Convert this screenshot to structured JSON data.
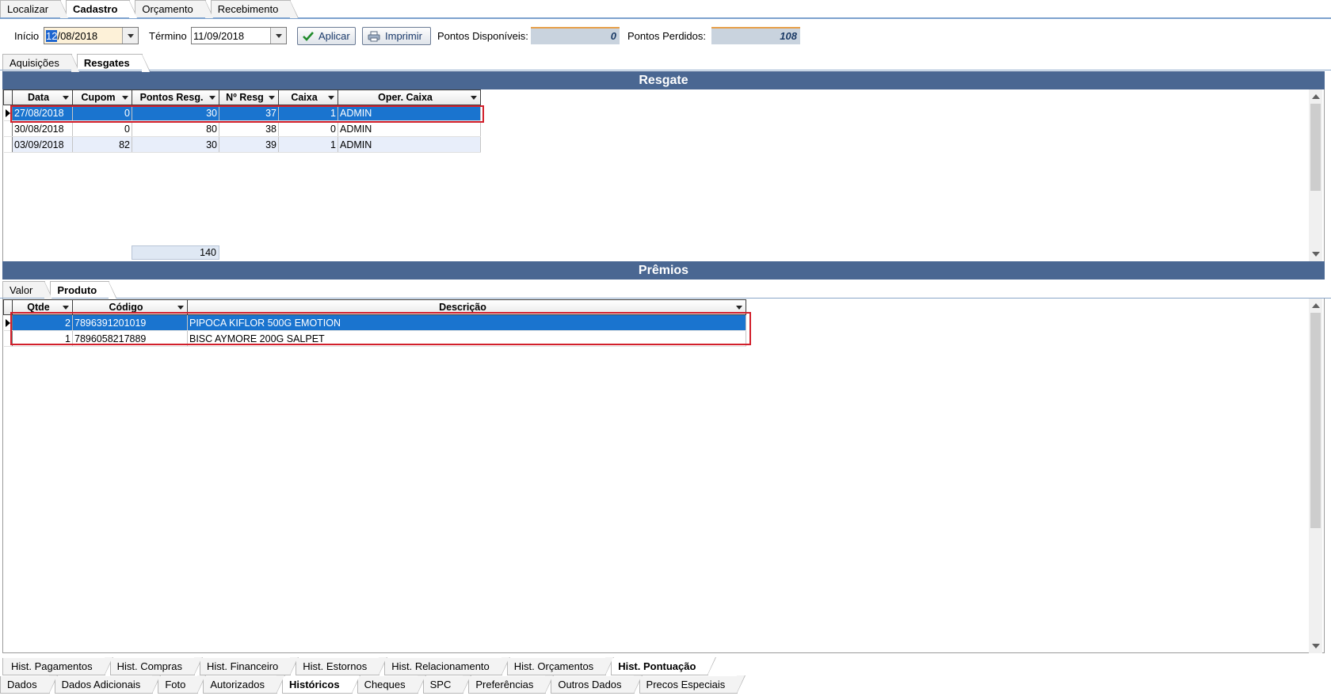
{
  "top_tabs": [
    {
      "label": "Localizar",
      "active": false
    },
    {
      "label": "Cadastro",
      "active": true
    },
    {
      "label": "Orçamento",
      "active": false
    },
    {
      "label": "Recebimento",
      "active": false
    }
  ],
  "filter": {
    "inicio_label": "Início",
    "inicio_day": "12",
    "inicio_rest": "/08/2018",
    "termino_label": "Término",
    "termino_value": "11/09/2018",
    "aplicar_label": "Aplicar",
    "imprimir_label": "Imprimir",
    "disponiveis_label": "Pontos Disponíveis:",
    "disponiveis_value": "0",
    "perdidos_label": "Pontos Perdidos:",
    "perdidos_value": "108"
  },
  "sub_tabs": [
    {
      "label": "Aquisições",
      "active": false
    },
    {
      "label": "Resgates",
      "active": true
    }
  ],
  "resgate": {
    "title": "Resgate",
    "columns": [
      "Data",
      "Cupom",
      "Pontos Resg.",
      "Nº Resg",
      "Caixa",
      "Oper. Caixa"
    ],
    "rows": [
      [
        "27/08/2018",
        "0",
        "30",
        "37",
        "1",
        "ADMIN"
      ],
      [
        "30/08/2018",
        "0",
        "80",
        "38",
        "0",
        "ADMIN"
      ],
      [
        "03/09/2018",
        "82",
        "30",
        "39",
        "1",
        "ADMIN"
      ]
    ],
    "total_pontos": "140"
  },
  "premios": {
    "title": "Prêmios",
    "tabs": [
      {
        "label": "Valor",
        "active": false
      },
      {
        "label": "Produto",
        "active": true
      }
    ],
    "columns": [
      "Qtde",
      "Código",
      "Descrição"
    ],
    "rows": [
      [
        "2",
        "7896391201019",
        "PIPOCA KIFLOR 500G EMOTION"
      ],
      [
        "1",
        "7896058217889",
        "BISC AYMORE 200G SALPET"
      ]
    ]
  },
  "hist_tabs": [
    {
      "label": "Hist. Pagamentos",
      "active": false
    },
    {
      "label": "Hist. Compras",
      "active": false
    },
    {
      "label": "Hist. Financeiro",
      "active": false
    },
    {
      "label": "Hist. Estornos",
      "active": false
    },
    {
      "label": "Hist. Relacionamento",
      "active": false
    },
    {
      "label": "Hist. Orçamentos",
      "active": false
    },
    {
      "label": "Hist. Pontuação",
      "active": true
    }
  ],
  "bottom_tabs": [
    {
      "label": "Dados",
      "active": false
    },
    {
      "label": "Dados Adicionais",
      "active": false
    },
    {
      "label": "Foto",
      "active": false
    },
    {
      "label": "Autorizados",
      "active": false
    },
    {
      "label": "Históricos",
      "active": true
    },
    {
      "label": "Cheques",
      "active": false
    },
    {
      "label": "SPC",
      "active": false
    },
    {
      "label": "Preferências",
      "active": false
    },
    {
      "label": "Outros Dados",
      "active": false
    },
    {
      "label": "Precos Especiais",
      "active": false
    }
  ],
  "colors": {
    "banner": "#4a6792",
    "selection": "#1a74cf",
    "highlight_box": "#d21f2b"
  }
}
